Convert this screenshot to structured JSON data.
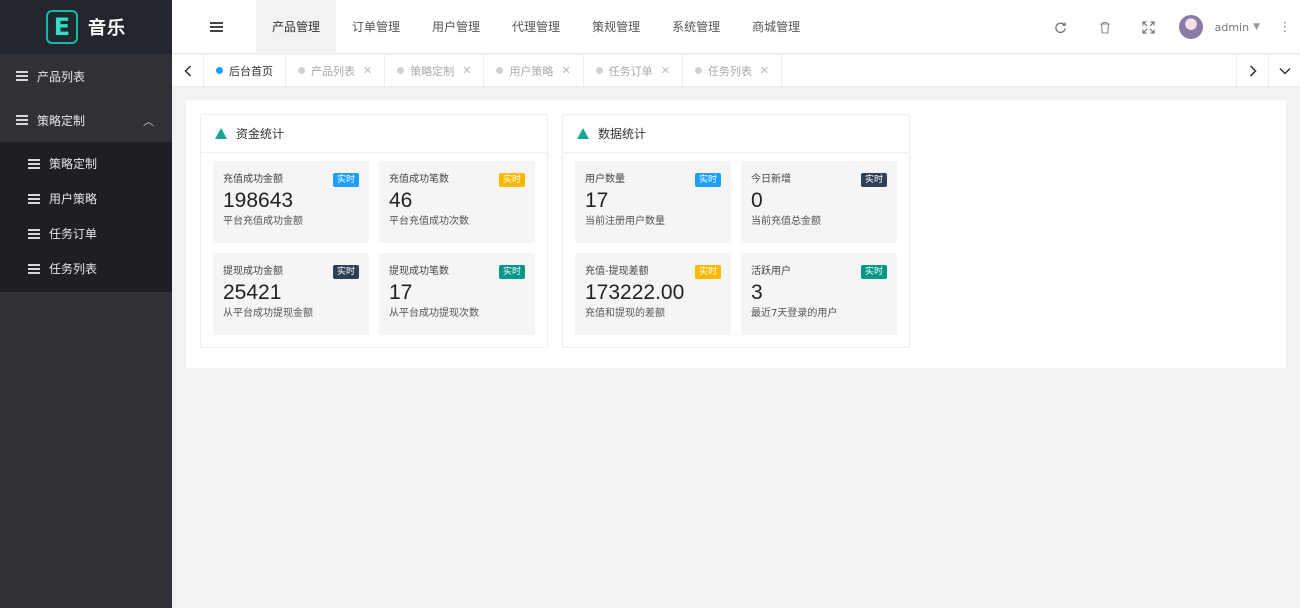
{
  "brand": {
    "logo_letter": "E",
    "name": "音乐"
  },
  "sidebar": {
    "items": [
      {
        "label": "产品列表"
      },
      {
        "label": "策略定制",
        "expanded": true,
        "children": [
          {
            "label": "策略定制"
          },
          {
            "label": "用户策略"
          },
          {
            "label": "任务订单"
          },
          {
            "label": "任务列表"
          }
        ]
      }
    ]
  },
  "header": {
    "nav": [
      {
        "label": "产品管理",
        "active": true
      },
      {
        "label": "订单管理"
      },
      {
        "label": "用户管理"
      },
      {
        "label": "代理管理"
      },
      {
        "label": "策规管理"
      },
      {
        "label": "系统管理"
      },
      {
        "label": "商城管理"
      }
    ],
    "icons": {
      "refresh": "refresh-icon",
      "delete": "trash-icon",
      "fullscreen": "fullscreen-icon",
      "more": "more-vertical-icon"
    },
    "user": "admin"
  },
  "tabs": [
    {
      "label": "后台首页",
      "active": true,
      "closable": false
    },
    {
      "label": "产品列表",
      "closable": true
    },
    {
      "label": "策略定制",
      "closable": true
    },
    {
      "label": "用户策略",
      "closable": true
    },
    {
      "label": "任务订单",
      "closable": true
    },
    {
      "label": "任务列表",
      "closable": true
    }
  ],
  "panels": {
    "funds": {
      "title": "资金统计",
      "cards": [
        {
          "title": "充值成功金额",
          "badge": "实时",
          "badge_color": "#1e9fff",
          "value": "198643",
          "desc": "平台充值成功金额"
        },
        {
          "title": "充值成功笔数",
          "badge": "实时",
          "badge_color": "#ffb800",
          "value": "46",
          "desc": "平台充值成功次数"
        },
        {
          "title": "提现成功金额",
          "badge": "实时",
          "badge_color": "#2f4056",
          "value": "25421",
          "desc": "从平台成功提现金额"
        },
        {
          "title": "提现成功笔数",
          "badge": "实时",
          "badge_color": "#009688",
          "value": "17",
          "desc": "从平台成功提现次数"
        }
      ]
    },
    "data": {
      "title": "数据统计",
      "cards": [
        {
          "title": "用户数量",
          "badge": "实时",
          "badge_color": "#1e9fff",
          "value": "17",
          "desc": "当前注册用户数量"
        },
        {
          "title": "今日新增",
          "badge": "实时",
          "badge_color": "#2f4056",
          "value": "0",
          "desc": "当前充值总金额"
        },
        {
          "title": "充值-提现差额",
          "badge": "实时",
          "badge_color": "#ffb800",
          "value": "173222.00",
          "desc": "充值和提现的差额"
        },
        {
          "title": "活跃用户",
          "badge": "实时",
          "badge_color": "#009688",
          "value": "3",
          "desc": "最近7天登录的用户"
        }
      ]
    }
  }
}
